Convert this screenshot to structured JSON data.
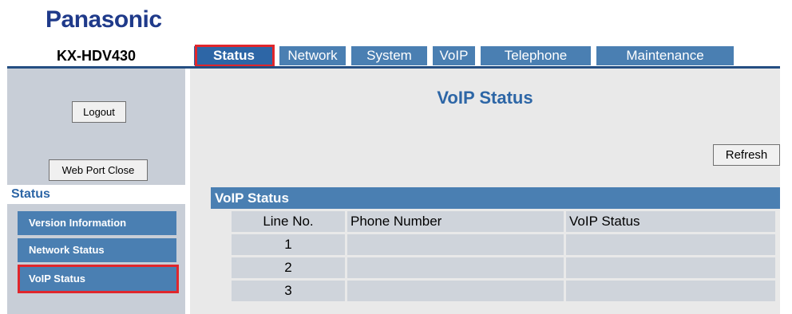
{
  "brand": {
    "logo": "Panasonic"
  },
  "device": {
    "model": "KX-HDV430"
  },
  "tabs": [
    {
      "label": "Status",
      "active": true
    },
    {
      "label": "Network"
    },
    {
      "label": "System"
    },
    {
      "label": "VoIP"
    },
    {
      "label": "Telephone"
    },
    {
      "label": "Maintenance"
    }
  ],
  "sidebar": {
    "logout_label": "Logout",
    "web_port_close_label": "Web Port Close",
    "heading": "Status",
    "items": [
      {
        "label": "Version Information"
      },
      {
        "label": "Network Status"
      },
      {
        "label": "VoIP Status",
        "selected": true
      }
    ]
  },
  "main": {
    "title": "VoIP Status",
    "refresh_label": "Refresh",
    "section_title": "VoIP Status",
    "table": {
      "columns": [
        "Line No.",
        "Phone Number",
        "VoIP Status"
      ],
      "rows": [
        [
          "1",
          "",
          ""
        ],
        [
          "2",
          "",
          ""
        ],
        [
          "3",
          "",
          ""
        ]
      ]
    }
  },
  "colors": {
    "accent": "#4a7fb2",
    "highlight": "#e0262c",
    "logo": "#1f3a8a"
  }
}
